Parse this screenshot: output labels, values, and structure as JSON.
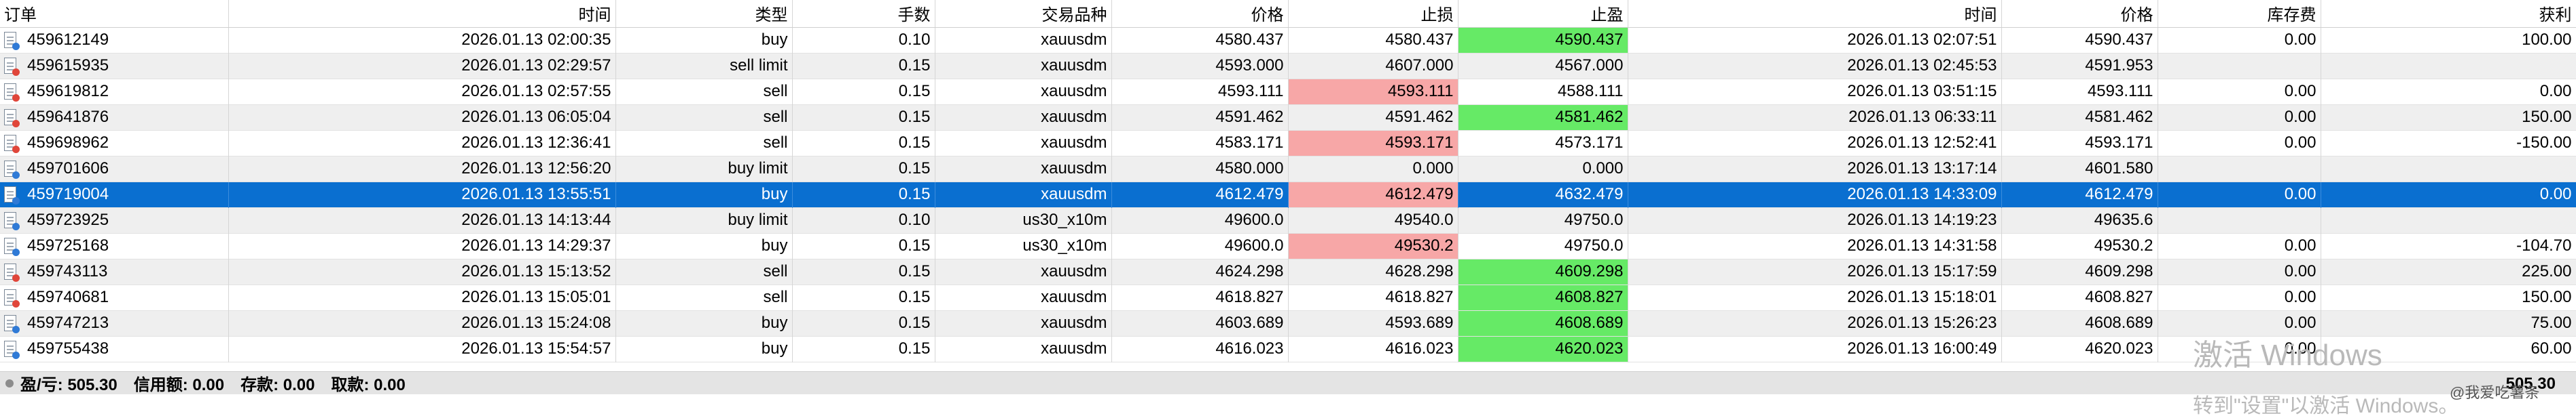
{
  "headers": {
    "order": "订单",
    "open_time": "时间",
    "type": "类型",
    "volume": "手数",
    "symbol": "交易品种",
    "open_price": "价格",
    "sl": "止损",
    "tp": "止盈",
    "close_time": "时间",
    "close_price": "价格",
    "swap": "库存费",
    "profit": "获利"
  },
  "rows": [
    {
      "order": "459612149",
      "open_time": "2026.01.13 02:00:35",
      "type": "buy",
      "volume": "0.10",
      "symbol": "xauusdm",
      "open_price": "4580.437",
      "sl": "4580.437",
      "tp": "4590.437",
      "close_time": "2026.01.13 02:07:51",
      "close_price": "4590.437",
      "swap": "0.00",
      "profit": "100.00",
      "sl_hit": false,
      "tp_hit": true,
      "selected": false
    },
    {
      "order": "459615935",
      "open_time": "2026.01.13 02:29:57",
      "type": "sell limit",
      "volume": "0.15",
      "symbol": "xauusdm",
      "open_price": "4593.000",
      "sl": "4607.000",
      "tp": "4567.000",
      "close_time": "2026.01.13 02:45:53",
      "close_price": "4591.953",
      "swap": "",
      "profit": "",
      "sl_hit": false,
      "tp_hit": false,
      "selected": false
    },
    {
      "order": "459619812",
      "open_time": "2026.01.13 02:57:55",
      "type": "sell",
      "volume": "0.15",
      "symbol": "xauusdm",
      "open_price": "4593.111",
      "sl": "4593.111",
      "tp": "4588.111",
      "close_time": "2026.01.13 03:51:15",
      "close_price": "4593.111",
      "swap": "0.00",
      "profit": "0.00",
      "sl_hit": true,
      "tp_hit": false,
      "selected": false
    },
    {
      "order": "459641876",
      "open_time": "2026.01.13 06:05:04",
      "type": "sell",
      "volume": "0.15",
      "symbol": "xauusdm",
      "open_price": "4591.462",
      "sl": "4591.462",
      "tp": "4581.462",
      "close_time": "2026.01.13 06:33:11",
      "close_price": "4581.462",
      "swap": "0.00",
      "profit": "150.00",
      "sl_hit": false,
      "tp_hit": true,
      "selected": false
    },
    {
      "order": "459698962",
      "open_time": "2026.01.13 12:36:41",
      "type": "sell",
      "volume": "0.15",
      "symbol": "xauusdm",
      "open_price": "4583.171",
      "sl": "4593.171",
      "tp": "4573.171",
      "close_time": "2026.01.13 12:52:41",
      "close_price": "4593.171",
      "swap": "0.00",
      "profit": "-150.00",
      "sl_hit": true,
      "tp_hit": false,
      "selected": false
    },
    {
      "order": "459701606",
      "open_time": "2026.01.13 12:56:20",
      "type": "buy limit",
      "volume": "0.15",
      "symbol": "xauusdm",
      "open_price": "4580.000",
      "sl": "0.000",
      "tp": "0.000",
      "close_time": "2026.01.13 13:17:14",
      "close_price": "4601.580",
      "swap": "",
      "profit": "",
      "sl_hit": false,
      "tp_hit": false,
      "selected": false
    },
    {
      "order": "459719004",
      "open_time": "2026.01.13 13:55:51",
      "type": "buy",
      "volume": "0.15",
      "symbol": "xauusdm",
      "open_price": "4612.479",
      "sl": "4612.479",
      "tp": "4632.479",
      "close_time": "2026.01.13 14:33:09",
      "close_price": "4612.479",
      "swap": "0.00",
      "profit": "0.00",
      "sl_hit": true,
      "tp_hit": false,
      "selected": true
    },
    {
      "order": "459723925",
      "open_time": "2026.01.13 14:13:44",
      "type": "buy limit",
      "volume": "0.10",
      "symbol": "us30_x10m",
      "open_price": "49600.0",
      "sl": "49540.0",
      "tp": "49750.0",
      "close_time": "2026.01.13 14:19:23",
      "close_price": "49635.6",
      "swap": "",
      "profit": "",
      "sl_hit": false,
      "tp_hit": false,
      "selected": false
    },
    {
      "order": "459725168",
      "open_time": "2026.01.13 14:29:37",
      "type": "buy",
      "volume": "0.15",
      "symbol": "us30_x10m",
      "open_price": "49600.0",
      "sl": "49530.2",
      "tp": "49750.0",
      "close_time": "2026.01.13 14:31:58",
      "close_price": "49530.2",
      "swap": "0.00",
      "profit": "-104.70",
      "sl_hit": true,
      "tp_hit": false,
      "selected": false
    },
    {
      "order": "459743113",
      "open_time": "2026.01.13 15:13:52",
      "type": "sell",
      "volume": "0.15",
      "symbol": "xauusdm",
      "open_price": "4624.298",
      "sl": "4628.298",
      "tp": "4609.298",
      "close_time": "2026.01.13 15:17:59",
      "close_price": "4609.298",
      "swap": "0.00",
      "profit": "225.00",
      "sl_hit": false,
      "tp_hit": true,
      "selected": false
    },
    {
      "order": "459740681",
      "open_time": "2026.01.13 15:05:01",
      "type": "sell",
      "volume": "0.15",
      "symbol": "xauusdm",
      "open_price": "4618.827",
      "sl": "4618.827",
      "tp": "4608.827",
      "close_time": "2026.01.13 15:18:01",
      "close_price": "4608.827",
      "swap": "0.00",
      "profit": "150.00",
      "sl_hit": false,
      "tp_hit": true,
      "selected": false
    },
    {
      "order": "459747213",
      "open_time": "2026.01.13 15:24:08",
      "type": "buy",
      "volume": "0.15",
      "symbol": "xauusdm",
      "open_price": "4603.689",
      "sl": "4593.689",
      "tp": "4608.689",
      "close_time": "2026.01.13 15:26:23",
      "close_price": "4608.689",
      "swap": "0.00",
      "profit": "75.00",
      "sl_hit": false,
      "tp_hit": true,
      "selected": false
    },
    {
      "order": "459755438",
      "open_time": "2026.01.13 15:54:57",
      "type": "buy",
      "volume": "0.15",
      "symbol": "xauusdm",
      "open_price": "4616.023",
      "sl": "4616.023",
      "tp": "4620.023",
      "close_time": "2026.01.13 16:00:49",
      "close_price": "4620.023",
      "swap": "0.00",
      "profit": "60.00",
      "sl_hit": false,
      "tp_hit": true,
      "selected": false
    }
  ],
  "status": {
    "pl": "盈/亏: 505.30",
    "credit": "信用额: 0.00",
    "deposit": "存款: 0.00",
    "withdrawal": "取款: 0.00",
    "total": "505.30"
  },
  "watermark": {
    "line1": "激活 Windows",
    "line2": "转到\"设置\"以激活 Windows。"
  },
  "weibo": "@我爱吃薯条",
  "colors": {
    "selected_row": "#0a6fd0",
    "sl_hit": "#f7a7a7",
    "tp_hit": "#66ea66",
    "alt_row": "#efefef"
  }
}
